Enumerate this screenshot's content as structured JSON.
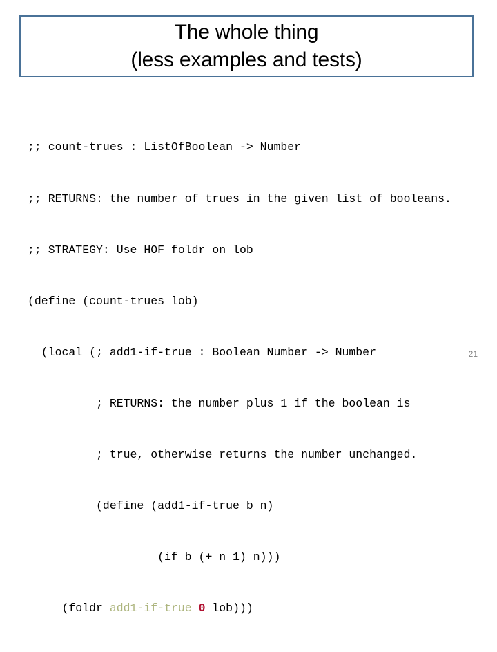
{
  "slide": {
    "background_color": "#ffffff",
    "accent_color": "#4a7298",
    "page_number": "21"
  },
  "title": {
    "line1": "The whole thing",
    "line2": "(less examples and tests)",
    "border_color": "#4a7298",
    "text_color": "#000000"
  },
  "code": {
    "language": "racket",
    "highlight_colors": {
      "identifier": "#adb57e",
      "number": "#b01030",
      "default": "#000000"
    },
    "lines": [
      {
        "id": "l1",
        "indent": 0,
        "text": ";; count-trues : ListOfBoolean -> Number"
      },
      {
        "id": "l2",
        "indent": 0,
        "text": ";; RETURNS: the number of trues in the given list of booleans."
      },
      {
        "id": "l3",
        "indent": 0,
        "text": ";; STRATEGY: Use HOF foldr on lob"
      },
      {
        "id": "l4",
        "indent": 0,
        "text": "(define (count-trues lob)"
      },
      {
        "id": "l5",
        "indent": 2,
        "text": "(local (; add1-if-true : Boolean Number -> Number"
      },
      {
        "id": "l6",
        "indent": 10,
        "text": "; RETURNS: the number plus 1 if the boolean is"
      },
      {
        "id": "l7",
        "indent": 10,
        "text": "; true, otherwise returns the number unchanged."
      },
      {
        "id": "l8",
        "indent": 10,
        "text": "(define (add1-if-true b n)"
      },
      {
        "id": "l9",
        "indent": 19,
        "text": "(if b (+ n 1) n)))"
      },
      {
        "id": "l10",
        "indent": 5,
        "pre": "(foldr ",
        "name": "add1-if-true",
        "mid": " ",
        "num": "0",
        "post": " lob)))"
      }
    ]
  }
}
